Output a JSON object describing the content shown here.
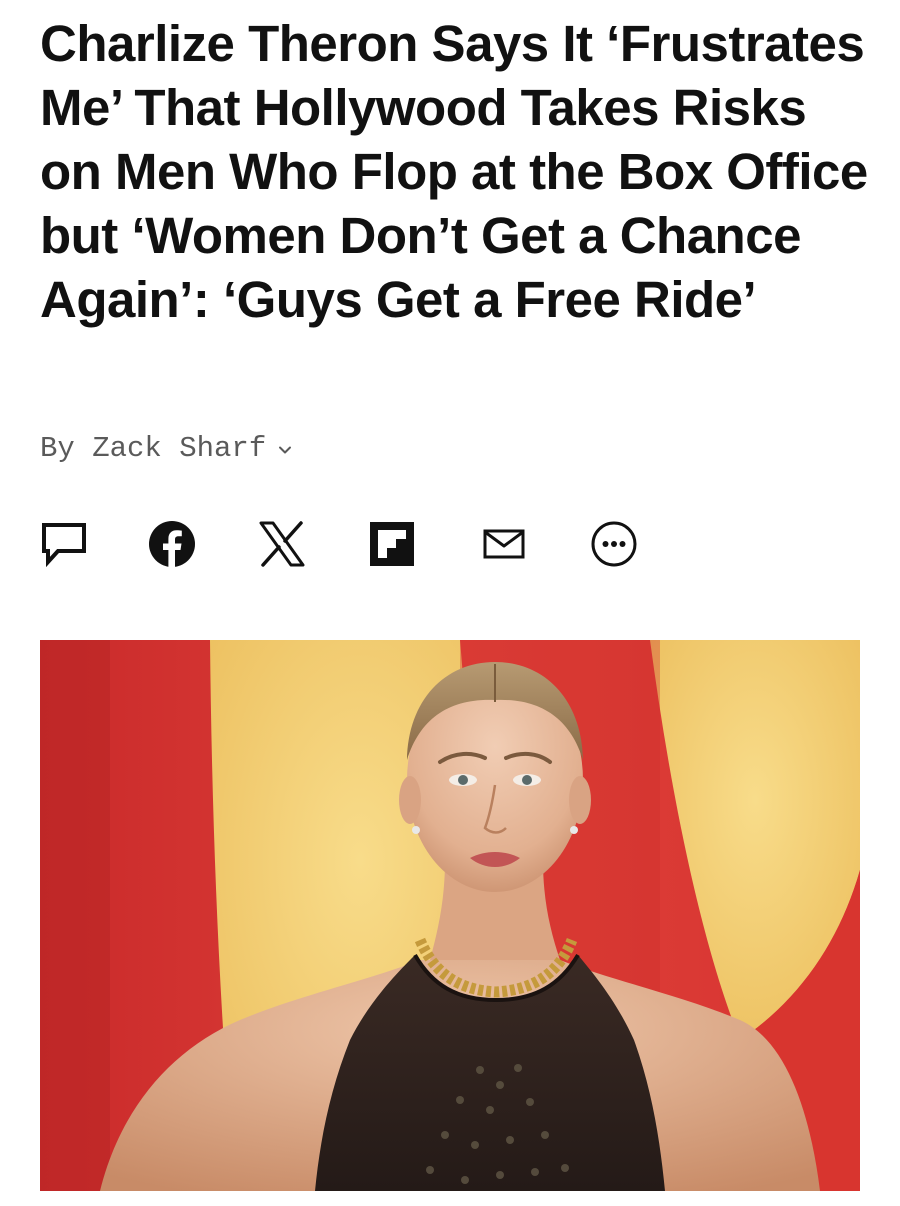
{
  "article": {
    "headline": "Charlize Theron Says It ‘Frustrates Me’ That Hollywood Takes Risks on Men Who Flop at the Box Office but ‘Women Don’t Get a Chance Again’: ‘Guys Get a Free Ride’",
    "byline": "By Zack Sharf"
  },
  "share_bar": {
    "icons": [
      "comment-icon",
      "facebook-icon",
      "x-icon",
      "flipboard-icon",
      "email-icon",
      "more-options-icon"
    ]
  },
  "hero_image": {
    "subject": "woman-portrait-photo",
    "colors": {
      "backdrop_red": "#d8352f",
      "backdrop_yellow": "#f2c96a"
    }
  }
}
